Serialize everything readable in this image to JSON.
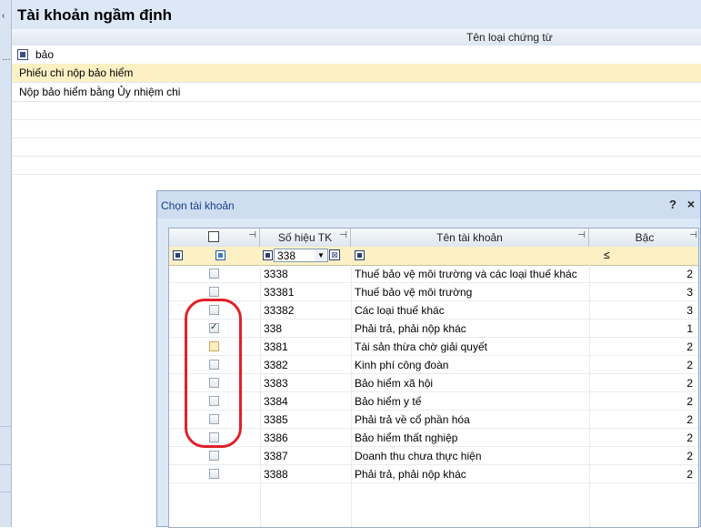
{
  "window": {
    "title": "Tài khoản ngầm định",
    "column_header": "Tên loại chứng từ",
    "filter_text": "bảo",
    "rows": [
      "Phiếu chi nộp bảo hiểm",
      "Nộp bảo hiểm bằng Ủy nhiệm chi"
    ]
  },
  "dialog": {
    "title": "Chọn tài khoản",
    "help_label": "?",
    "close_label": "×",
    "columns": {
      "account_no": "Số hiệu TK",
      "account_name": "Tên tài khoản",
      "level": "Bậc"
    },
    "filter": {
      "account_no_value": "338",
      "level_operator": "≤"
    },
    "rows": [
      {
        "checked": false,
        "no": "3338",
        "name": "Thuế bảo vệ môi trường và các loại thuế khác",
        "level": "2"
      },
      {
        "checked": false,
        "no": "33381",
        "name": "Thuế bảo vệ môi trường",
        "level": "3"
      },
      {
        "checked": false,
        "no": "33382",
        "name": "Các loại thuế khác",
        "level": "3"
      },
      {
        "checked": true,
        "no": "338",
        "name": "Phải trả, phải nộp khác",
        "level": "1"
      },
      {
        "checked": false,
        "no": "3381",
        "name": "Tài sản thừa chờ giải quyết",
        "level": "2",
        "hover": true
      },
      {
        "checked": false,
        "no": "3382",
        "name": "Kinh phí công đoàn",
        "level": "2"
      },
      {
        "checked": false,
        "no": "3383",
        "name": "Bảo hiểm xã hội",
        "level": "2"
      },
      {
        "checked": false,
        "no": "3384",
        "name": "Bảo hiểm y tế",
        "level": "2"
      },
      {
        "checked": false,
        "no": "3385",
        "name": "Phải trả về cổ phần hóa",
        "level": "2"
      },
      {
        "checked": false,
        "no": "3386",
        "name": "Bảo hiểm thất nghiệp",
        "level": "2"
      },
      {
        "checked": false,
        "no": "3387",
        "name": "Doanh thu chưa thực hiện",
        "level": "2"
      },
      {
        "checked": false,
        "no": "3388",
        "name": "Phải trả, phải nộp khác",
        "level": "2"
      }
    ]
  },
  "colors": {
    "selected_row": "#fcf0c4",
    "highlight_annotation": "#e0202a",
    "dialog_title": "#15428b"
  }
}
